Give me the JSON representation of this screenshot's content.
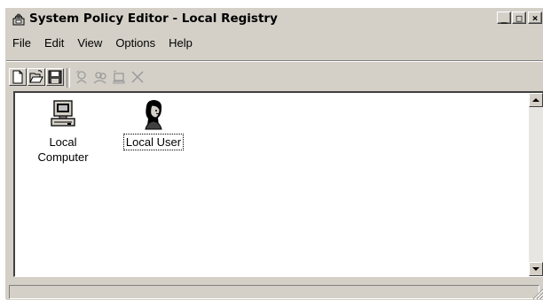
{
  "window": {
    "title": "System Policy Editor - Local Registry",
    "icon": "policy-editor-icon",
    "caption_buttons": {
      "minimize": "_",
      "maximize": "□",
      "close": "×"
    }
  },
  "menu": [
    "File",
    "Edit",
    "View",
    "Options",
    "Help"
  ],
  "toolbar": [
    {
      "icon": "new-document-icon",
      "enabled": true
    },
    {
      "icon": "open-folder-icon",
      "enabled": true
    },
    {
      "icon": "save-disk-icon",
      "enabled": true
    },
    {
      "icon": "add-user-icon",
      "enabled": false
    },
    {
      "icon": "add-group-icon",
      "enabled": false
    },
    {
      "icon": "add-computer-icon",
      "enabled": false
    },
    {
      "icon": "remove-x-icon",
      "enabled": false
    }
  ],
  "items": [
    {
      "label": "Local Computer",
      "icon": "computer-icon",
      "selected": false
    },
    {
      "label": "Local User",
      "icon": "user-icon",
      "selected": true
    }
  ],
  "status": {
    "text": ""
  }
}
